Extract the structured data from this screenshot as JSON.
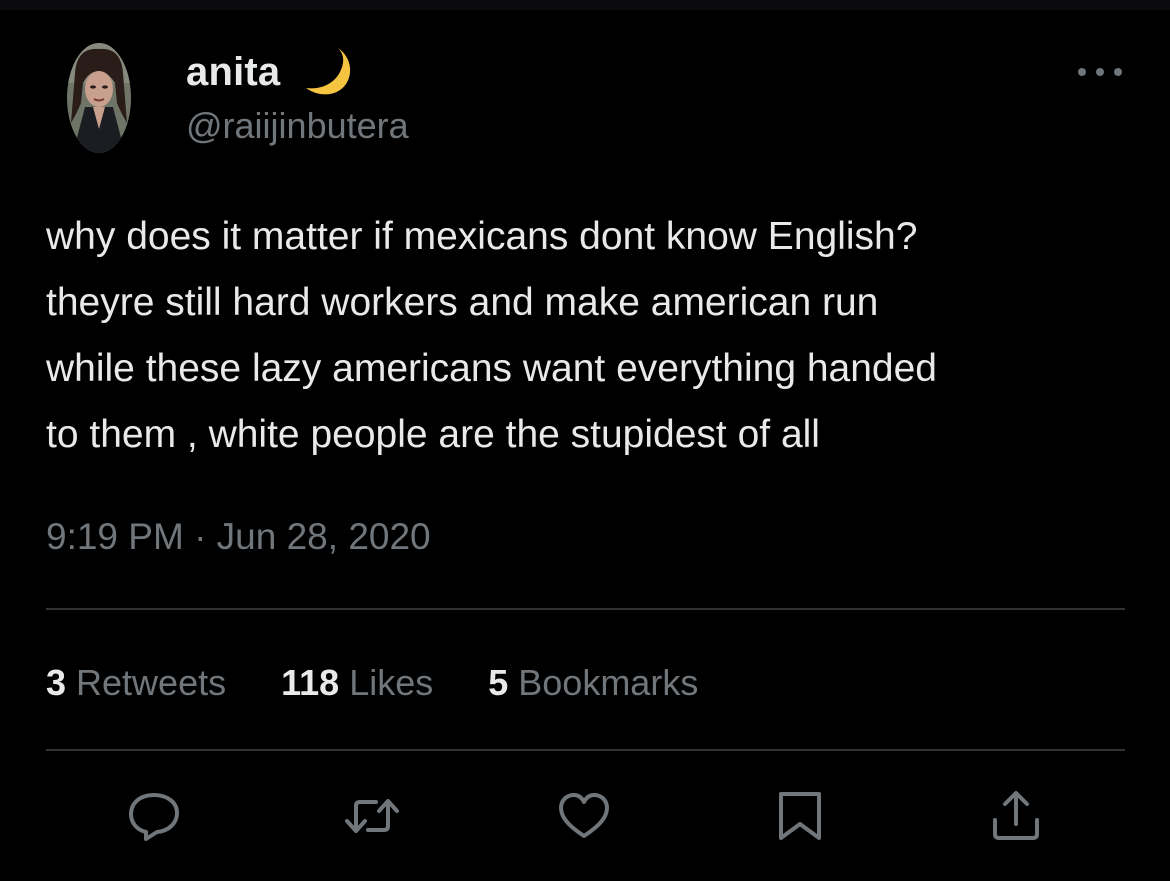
{
  "user": {
    "display_name": "anita",
    "handle": "@raiijinbutera",
    "name_emoji": "crescent-moon-icon",
    "avatar": "avatar-photo"
  },
  "tweet": {
    "lines": [
      "why does it matter if mexicans dont know English?",
      "theyre still hard workers and make american run",
      "while these lazy americans want everything handed",
      "to them , white people are the stupidest of all"
    ],
    "timestamp": "9:19 PM · Jun 28, 2020"
  },
  "stats": {
    "retweets": {
      "count": "3",
      "label": "Retweets"
    },
    "likes": {
      "count": "118",
      "label": "Likes"
    },
    "bookmarks": {
      "count": "5",
      "label": "Bookmarks"
    }
  },
  "actions": [
    "reply-icon",
    "retweet-icon",
    "like-icon",
    "bookmark-icon",
    "share-icon"
  ],
  "colors": {
    "background": "#000000",
    "primary_text": "#e7e9ea",
    "secondary_text": "#71767b",
    "divider": "#2f3336",
    "moon": "#f5c542"
  }
}
